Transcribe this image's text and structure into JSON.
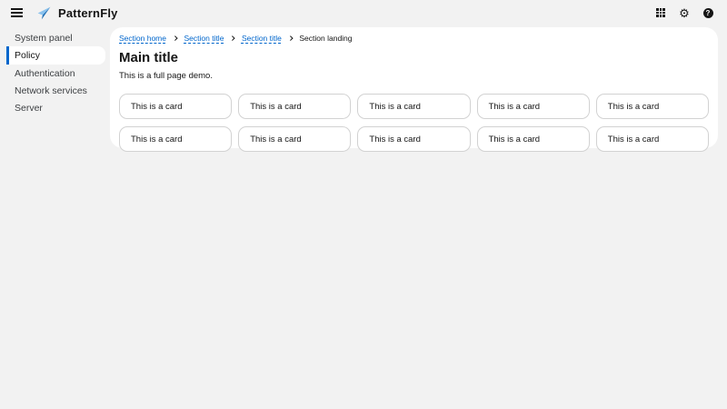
{
  "masthead": {
    "brand": "PatternFly",
    "menu_icon": "hamburger-menu",
    "toolbar_icons": [
      "apps-grid",
      "settings-gear",
      "help-question-circle"
    ],
    "help_glyph": "?",
    "gear_glyph": "⚙"
  },
  "sidebar": {
    "items": [
      {
        "label": "System panel",
        "selected": false
      },
      {
        "label": "Policy",
        "selected": true
      },
      {
        "label": "Authentication",
        "selected": false
      },
      {
        "label": "Network services",
        "selected": false
      },
      {
        "label": "Server",
        "selected": false
      }
    ]
  },
  "breadcrumb": {
    "items": [
      {
        "label": "Section home",
        "link": true
      },
      {
        "label": "Section title",
        "link": true
      },
      {
        "label": "Section title",
        "link": true
      },
      {
        "label": "Section landing",
        "link": false
      }
    ]
  },
  "main": {
    "title": "Main title",
    "description": "This is a full page demo.",
    "cards": [
      "This is a card",
      "This is a card",
      "This is a card",
      "This is a card",
      "This is a card",
      "This is a card",
      "This is a card",
      "This is a card",
      "This is a card",
      "This is a card"
    ]
  },
  "colors": {
    "accent": "#0066cc",
    "link": "#0066cc",
    "text": "#151515",
    "page_bg": "#f2f2f2",
    "chrome_bg": "#f2f2f2",
    "panel_bg": "#ffffff",
    "card_border": "#d2d2d2",
    "logo_light_blue": "#8ac2ee",
    "logo_dark_blue": "#1f6fb5"
  }
}
